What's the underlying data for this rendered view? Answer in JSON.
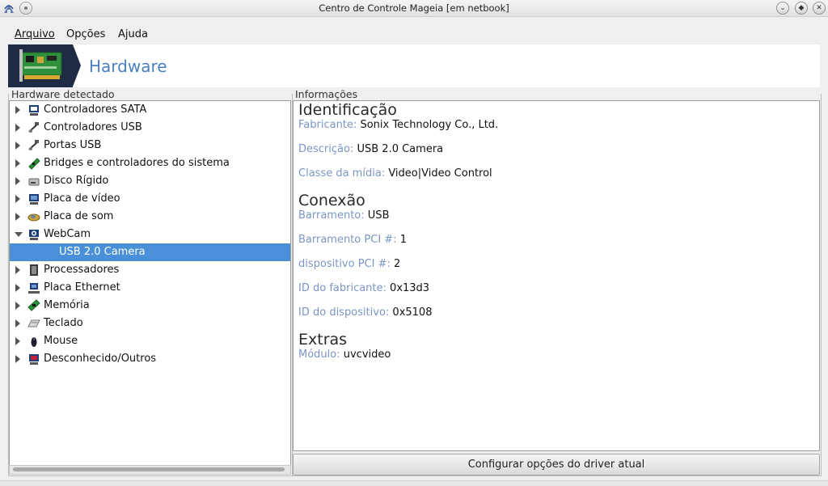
{
  "window": {
    "title": "Centro de Controle Mageia  [em netbook]",
    "buttons": [
      "minimize",
      "maximize",
      "close"
    ]
  },
  "menubar": {
    "items": [
      {
        "label": "Arquivo",
        "mnemonic": "A"
      },
      {
        "label": "Opções",
        "mnemonic": "O"
      },
      {
        "label": "Ajuda",
        "mnemonic": "u"
      }
    ]
  },
  "header": {
    "title": "Hardware",
    "accent_color": "#4a7fc1",
    "icon": "pci-card-icon"
  },
  "left_panel": {
    "label": "Hardware detectado",
    "items": [
      {
        "label": "Controladores SATA",
        "icon": "sata-controller-icon",
        "expanded": false,
        "selected": false,
        "child": false
      },
      {
        "label": "Controladores USB",
        "icon": "usb-controller-icon",
        "expanded": false,
        "selected": false,
        "child": false
      },
      {
        "label": "Portas USB",
        "icon": "usb-port-icon",
        "expanded": false,
        "selected": false,
        "child": false
      },
      {
        "label": "Bridges e controladores do sistema",
        "icon": "bridge-icon",
        "expanded": false,
        "selected": false,
        "child": false
      },
      {
        "label": "Disco Rígido",
        "icon": "hard-disk-icon",
        "expanded": false,
        "selected": false,
        "child": false
      },
      {
        "label": "Placa de vídeo",
        "icon": "video-card-icon",
        "expanded": false,
        "selected": false,
        "child": false
      },
      {
        "label": "Placa de som",
        "icon": "sound-card-icon",
        "expanded": false,
        "selected": false,
        "child": false
      },
      {
        "label": "WebCam",
        "icon": "webcam-icon",
        "expanded": true,
        "selected": false,
        "child": false
      },
      {
        "label": "USB 2.0 Camera",
        "icon": "",
        "expanded": false,
        "selected": true,
        "child": true
      },
      {
        "label": "Processadores",
        "icon": "processor-icon",
        "expanded": false,
        "selected": false,
        "child": false
      },
      {
        "label": "Placa Ethernet",
        "icon": "ethernet-icon",
        "expanded": false,
        "selected": false,
        "child": false
      },
      {
        "label": "Memória",
        "icon": "memory-icon",
        "expanded": false,
        "selected": false,
        "child": false
      },
      {
        "label": "Teclado",
        "icon": "keyboard-icon",
        "expanded": false,
        "selected": false,
        "child": false
      },
      {
        "label": "Mouse",
        "icon": "mouse-icon",
        "expanded": false,
        "selected": false,
        "child": false
      },
      {
        "label": "Desconhecido/Outros",
        "icon": "unknown-device-icon",
        "expanded": false,
        "selected": false,
        "child": false
      }
    ]
  },
  "right_panel": {
    "label": "Informações",
    "label_color": "#7c95c4",
    "sections": {
      "identificacao": {
        "title": "Identificação",
        "fabricante": {
          "label": "Fabricante:",
          "value": "Sonix Technology Co., Ltd."
        },
        "descricao": {
          "label": "Descrição:",
          "value": "USB 2.0 Camera"
        },
        "classe": {
          "label": "Classe da mídia:",
          "value": "Video|Video Control"
        }
      },
      "conexao": {
        "title": "Conexão",
        "barramento": {
          "label": "Barramento:",
          "value": "USB"
        },
        "barramento_pci": {
          "label": "Barramento PCI #:",
          "value": "1"
        },
        "dispositivo_pci": {
          "label": "dispositivo PCI #:",
          "value": "2"
        },
        "id_fabricante": {
          "label": "ID do fabricante:",
          "value": "0x13d3"
        },
        "id_dispositivo": {
          "label": "ID do dispositivo:",
          "value": "0x5108"
        }
      },
      "extras": {
        "title": "Extras",
        "modulo": {
          "label": "Módulo:",
          "value": "uvcvideo"
        }
      }
    },
    "configure_button": "Configurar opções do driver atual"
  },
  "colors": {
    "selection": "#4a90d9",
    "banner_dark": "#1e2b45"
  }
}
